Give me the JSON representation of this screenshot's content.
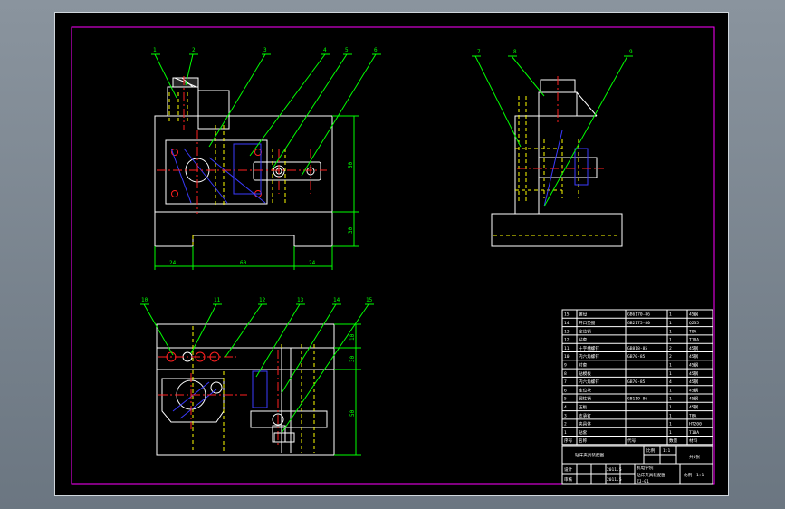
{
  "colors": {
    "viewport_bg": "#7b8590",
    "canvas_bg": "#000000",
    "outline": "#ffffff",
    "frame": "#ff00ff",
    "leader": "#00ff00",
    "hidden": "#ffff00",
    "center": "#ff0000",
    "section": "#0000ff"
  },
  "view_front": {
    "callouts": [
      "1",
      "2",
      "3",
      "4",
      "5",
      "6"
    ],
    "dims": {
      "height_upper": "50",
      "height_lower": "30",
      "width_left": "24",
      "width_mid": "60",
      "width_right": "24"
    }
  },
  "view_side": {
    "callouts": [
      "7",
      "8",
      "9"
    ]
  },
  "view_top": {
    "callouts": [
      "10",
      "11",
      "12",
      "13",
      "14",
      "15"
    ],
    "dims": {
      "d1": "10",
      "d2": "30",
      "d3": "50"
    }
  },
  "bom": {
    "rows": [
      {
        "no": "15",
        "name": "螺母",
        "std": "GB6170-86",
        "qty": "1",
        "mat": "45钢"
      },
      {
        "no": "14",
        "name": "开口垫圈",
        "std": "GB2175-80",
        "qty": "1",
        "mat": "Q235"
      },
      {
        "no": "13",
        "name": "定位销",
        "std": "",
        "qty": "1",
        "mat": "T8A"
      },
      {
        "no": "12",
        "name": "钻套",
        "std": "",
        "qty": "1",
        "mat": "T10A"
      },
      {
        "no": "11",
        "name": "十字槽螺钉",
        "std": "GB818-85",
        "qty": "2",
        "mat": "45钢"
      },
      {
        "no": "10",
        "name": "内六角螺钉",
        "std": "GB70-85",
        "qty": "2",
        "mat": "45钢"
      },
      {
        "no": "9",
        "name": "衬套",
        "std": "",
        "qty": "1",
        "mat": "45钢"
      },
      {
        "no": "8",
        "name": "钻模板",
        "std": "",
        "qty": "1",
        "mat": "45钢"
      },
      {
        "no": "7",
        "name": "内六角螺钉",
        "std": "GB70-85",
        "qty": "4",
        "mat": "45钢"
      },
      {
        "no": "6",
        "name": "定位块",
        "std": "",
        "qty": "1",
        "mat": "45钢"
      },
      {
        "no": "5",
        "name": "圆柱销",
        "std": "GB119-86",
        "qty": "1",
        "mat": "45钢"
      },
      {
        "no": "4",
        "name": "压板",
        "std": "",
        "qty": "1",
        "mat": "45钢"
      },
      {
        "no": "3",
        "name": "支承钉",
        "std": "",
        "qty": "1",
        "mat": "T8A"
      },
      {
        "no": "2",
        "name": "夹具体",
        "std": "",
        "qty": "1",
        "mat": "HT200"
      },
      {
        "no": "1",
        "name": "钻套",
        "std": "",
        "qty": "1",
        "mat": "T10A"
      }
    ],
    "header": {
      "no": "序号",
      "name": "名称",
      "std": "代号",
      "qty": "数量",
      "mat": "材料"
    }
  },
  "title_block": {
    "drawing_title": "钻床夹具装配图",
    "scale_label": "比例",
    "scale": "1:1",
    "sheet": "共1张",
    "design": "设计",
    "check": "审核",
    "date": "2011.5",
    "school": "机电学院",
    "drawing_no": "ZJ-01"
  }
}
